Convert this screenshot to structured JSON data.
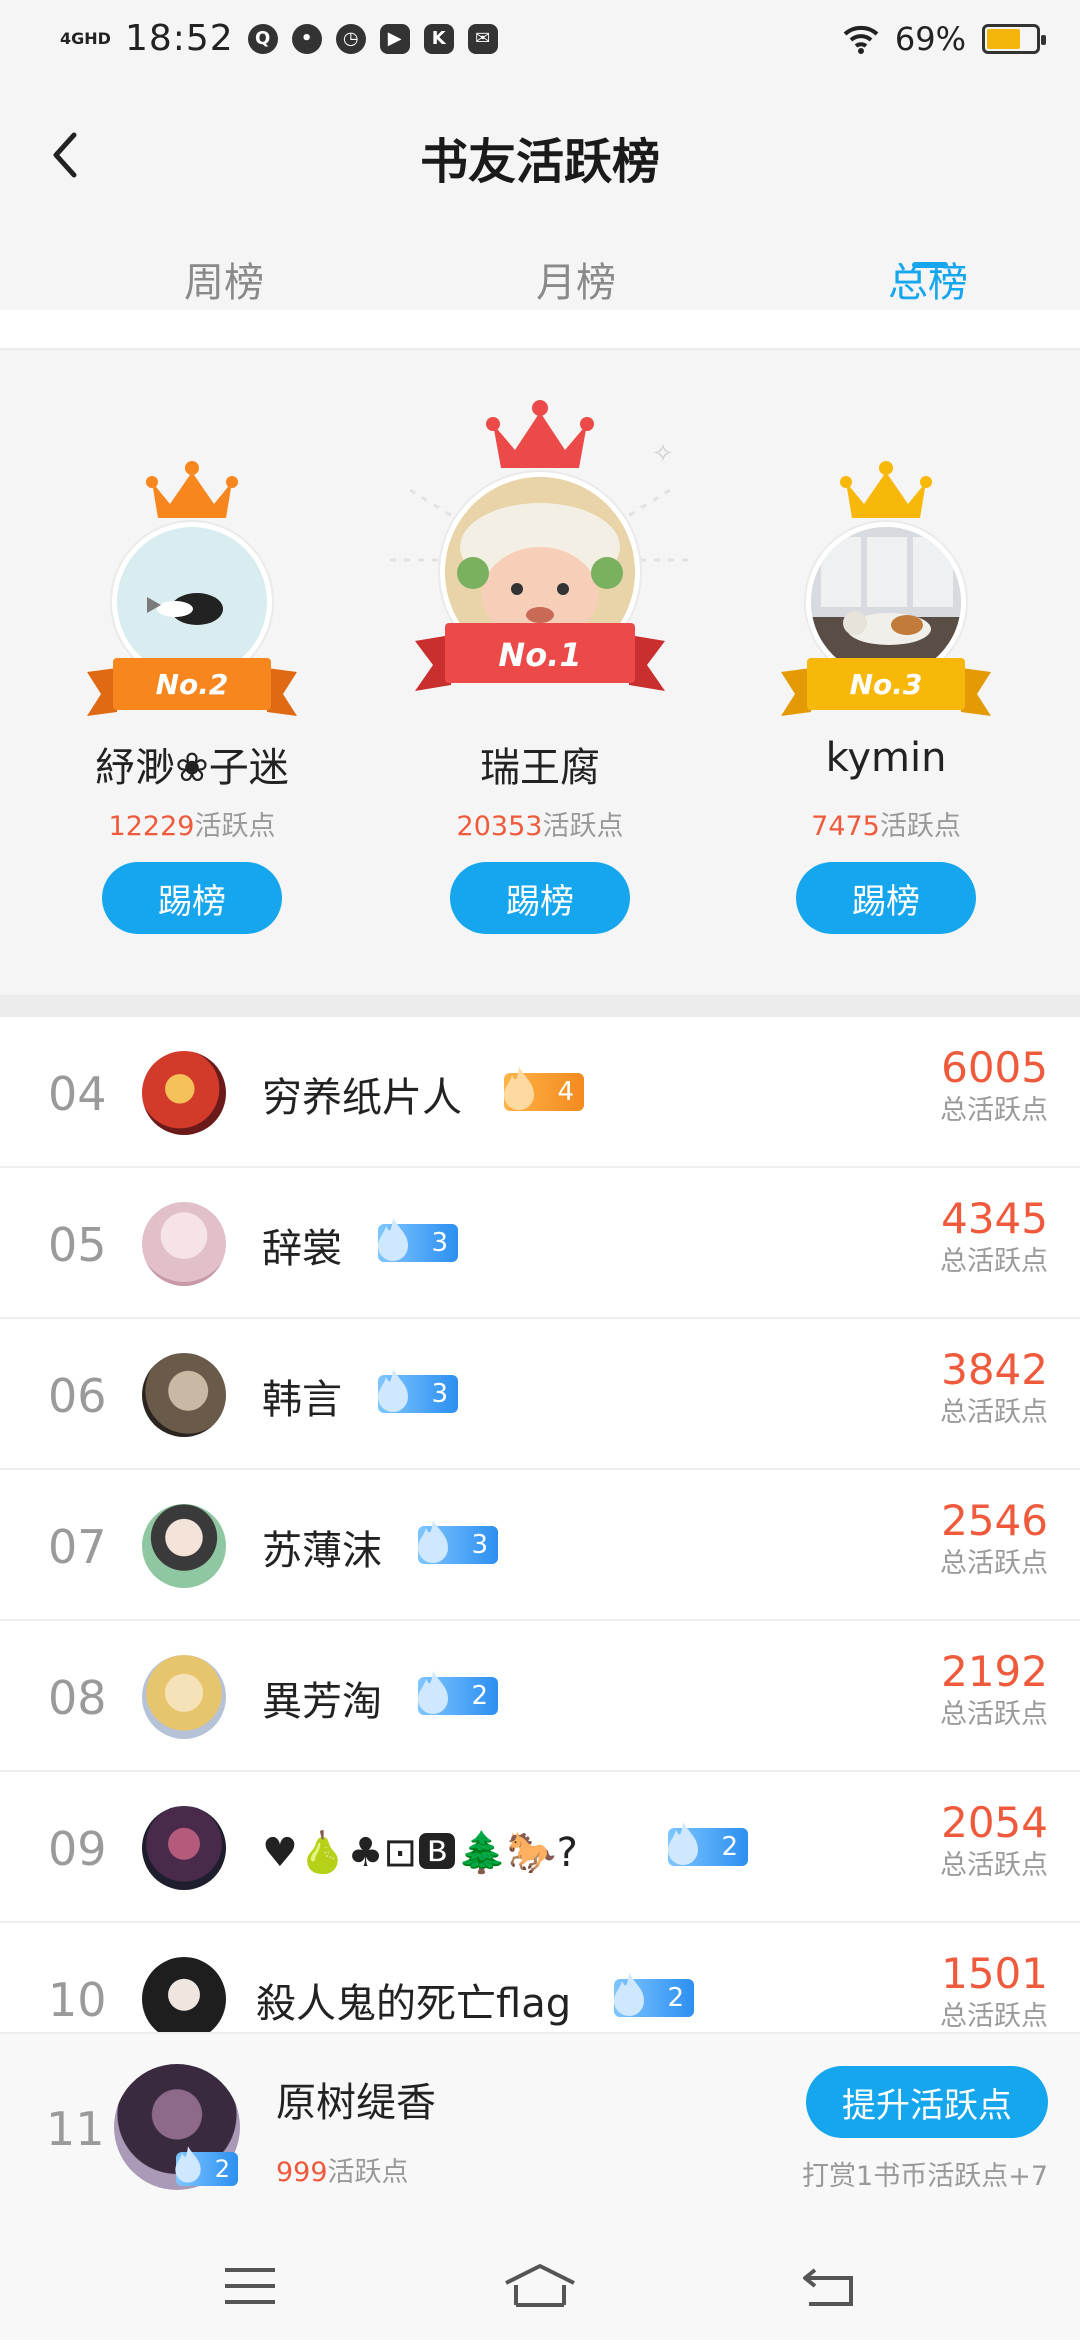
{
  "status_bar": {
    "network": "4GHD",
    "time": "18:52",
    "battery_percent": "69%",
    "battery_level": 0.69,
    "app_icons": [
      "Q",
      "chat",
      "clock",
      "play",
      "K",
      "mail"
    ]
  },
  "header": {
    "title": "书友活跃榜",
    "tabs": [
      "周榜",
      "月榜",
      "总榜"
    ],
    "active_tab": "总榜"
  },
  "podium": [
    {
      "rank_label": "No.2",
      "name": "紓渺❀子迷",
      "points": "12229",
      "points_suffix": "活跃点",
      "button": "踢榜",
      "crown_color": "#f7861f"
    },
    {
      "rank_label": "No.1",
      "name": "瑞王腐",
      "points": "20353",
      "points_suffix": "活跃点",
      "button": "踢榜",
      "crown_color": "#ec4a49"
    },
    {
      "rank_label": "No.3",
      "name": "kymin",
      "points": "7475",
      "points_suffix": "活跃点",
      "button": "踢榜",
      "crown_color": "#f7b80a"
    }
  ],
  "list": [
    {
      "rank": "04",
      "name": "穷养纸片人",
      "level": "4",
      "level_color": "orange",
      "points": "6005",
      "points_label": "总活跃点"
    },
    {
      "rank": "05",
      "name": "辞裳",
      "level": "3",
      "level_color": "blue",
      "points": "4345",
      "points_label": "总活跃点"
    },
    {
      "rank": "06",
      "name": "韩言",
      "level": "3",
      "level_color": "blue",
      "points": "3842",
      "points_label": "总活跃点"
    },
    {
      "rank": "07",
      "name": "苏薄沫",
      "level": "3",
      "level_color": "blue",
      "points": "2546",
      "points_label": "总活跃点"
    },
    {
      "rank": "08",
      "name": "異芳淘",
      "level": "2",
      "level_color": "blue",
      "points": "2192",
      "points_label": "总活跃点"
    },
    {
      "rank": "09",
      "name": "♥🍐♣⊡🅱🌲🐎?",
      "level": "2",
      "level_color": "blue",
      "points": "2054",
      "points_label": "总活跃点"
    },
    {
      "rank": "10",
      "name": "殺人鬼的死亡flag",
      "level": "2",
      "level_color": "blue",
      "points": "1501",
      "points_label": "总活跃点"
    }
  ],
  "my_rank": {
    "rank": "11",
    "name": "原树缇香",
    "level": "2",
    "points": "999",
    "points_suffix": "活跃点",
    "button": "提升活跃点",
    "hint": "打赏1书币活跃点+7"
  },
  "nav": [
    "menu",
    "home",
    "back"
  ]
}
